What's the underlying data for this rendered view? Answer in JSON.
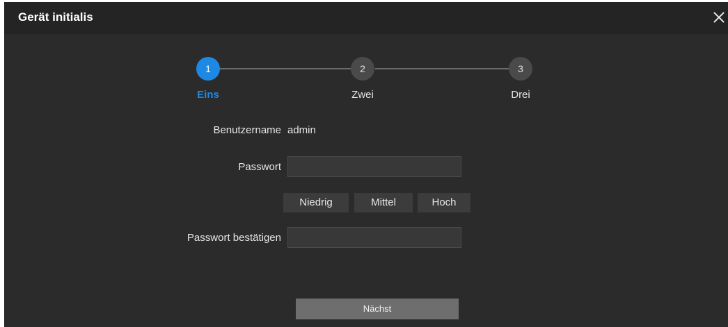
{
  "dialog": {
    "title": "Gerät initialis",
    "close_icon": "close-icon"
  },
  "steps": [
    {
      "number": "1",
      "label": "Eins",
      "active": true
    },
    {
      "number": "2",
      "label": "Zwei",
      "active": false
    },
    {
      "number": "3",
      "label": "Drei",
      "active": false
    }
  ],
  "form": {
    "username_label": "Benutzername",
    "username_value": "admin",
    "password_label": "Passwort",
    "password_value": "",
    "confirm_label": "Passwort bestätigen",
    "confirm_value": "",
    "strength": [
      "Niedrig",
      "Mittel",
      "Hoch"
    ]
  },
  "actions": {
    "next_label": "Nächst"
  },
  "colors": {
    "accent": "#1e88e5",
    "background": "#2b2b2b",
    "titlebar": "#242424"
  }
}
